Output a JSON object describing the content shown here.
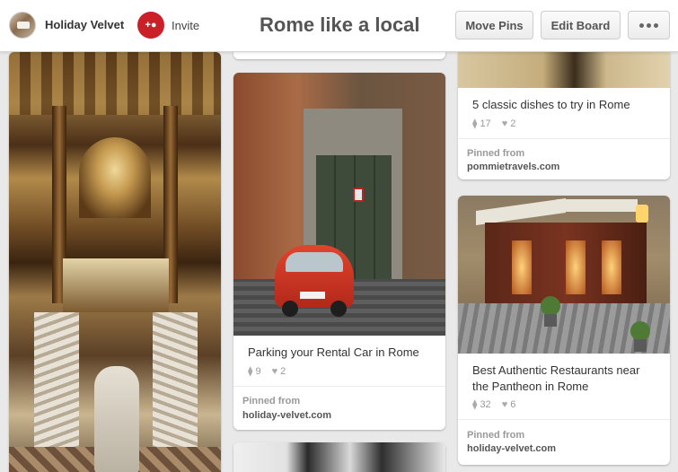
{
  "header": {
    "board_owner": "Holiday Velvet",
    "invite_label": "Invite",
    "board_title": "Rome like a local",
    "buttons": {
      "move_pins": "Move Pins",
      "edit_board": "Edit Board"
    }
  },
  "pins": [
    {
      "id": "parking",
      "title": "Parking your Rental Car in Rome",
      "repins": "9",
      "likes": "2",
      "pinned_from_label": "Pinned from",
      "source": "holiday-velvet.com"
    },
    {
      "id": "dishes",
      "title": "5 classic dishes to try in Rome",
      "repins": "17",
      "likes": "2",
      "pinned_from_label": "Pinned from",
      "source": "pommietravels.com"
    },
    {
      "id": "restaurants",
      "title_line1": "Best Authentic Restaurants near",
      "title_line2": "the Pantheon in Rome",
      "repins": "32",
      "likes": "6",
      "pinned_from_label": "Pinned from",
      "source": "holiday-velvet.com"
    }
  ],
  "icons": {
    "repin": "pin-icon",
    "like": "heart-icon",
    "more": "more-dots-icon",
    "invite": "invite-user-icon"
  },
  "colors": {
    "invite_red": "#cb2027",
    "background": "#e9e9e9"
  }
}
